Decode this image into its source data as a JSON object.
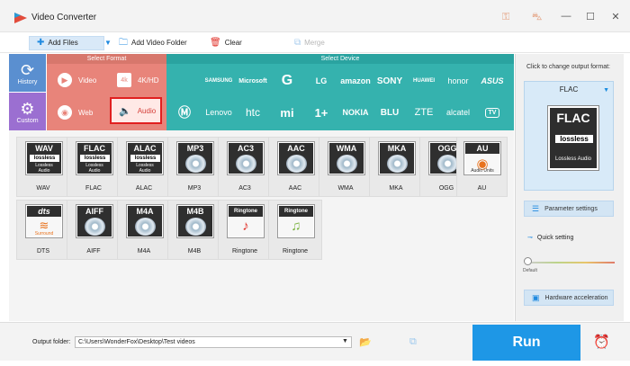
{
  "window": {
    "title": "Video Converter",
    "controls": [
      "—",
      "☐",
      "✕"
    ]
  },
  "toolbar": {
    "add_files": "Add Files",
    "add_video_folder": "Add Video Folder",
    "clear": "Clear",
    "merge": "Merge"
  },
  "sidebar": {
    "history": "History",
    "custom": "Custom"
  },
  "headers": {
    "select_format": "Select Format",
    "select_device": "Select Device"
  },
  "categories": {
    "video": "Video",
    "k4hd": "4K/HD",
    "web": "Web",
    "audio": "Audio",
    "selected": "Audio"
  },
  "devices": {
    "row1": [
      "",
      "SAMSUNG",
      "Microsoft",
      "G",
      "LG",
      "amazon",
      "SONY",
      "HUAWEI",
      "honor",
      "ASUS"
    ],
    "row2": [
      "",
      "Lenovo",
      "htc",
      "mi",
      "1+",
      "NOKIA",
      "BLU",
      "ZTE",
      "alcatel",
      "TV"
    ]
  },
  "formats": [
    {
      "badge": "WAV",
      "label": "WAV",
      "kind": "lossless"
    },
    {
      "badge": "FLAC",
      "label": "FLAC",
      "kind": "lossless"
    },
    {
      "badge": "ALAC",
      "label": "ALAC",
      "kind": "lossless"
    },
    {
      "badge": "MP3",
      "label": "MP3",
      "kind": "disc"
    },
    {
      "badge": "AC3",
      "label": "AC3",
      "kind": "disc"
    },
    {
      "badge": "AAC",
      "label": "AAC",
      "kind": "disc"
    },
    {
      "badge": "WMA",
      "label": "WMA",
      "kind": "disc"
    },
    {
      "badge": "MKA",
      "label": "MKA",
      "kind": "disc"
    },
    {
      "badge": "OGG",
      "label": "OGG",
      "kind": "disc"
    },
    {
      "badge": "AU",
      "label": "AU",
      "kind": "au",
      "sub": "Audio Units"
    },
    {
      "badge": "dts",
      "label": "DTS",
      "kind": "dts",
      "sub": "Surround"
    },
    {
      "badge": "AIFF",
      "label": "AIFF",
      "kind": "disc"
    },
    {
      "badge": "M4A",
      "label": "M4A",
      "kind": "disc"
    },
    {
      "badge": "M4B",
      "label": "M4B",
      "kind": "disc"
    },
    {
      "badge": "Ringtone",
      "label": "Ringtone",
      "kind": "apple"
    },
    {
      "badge": "Ringtone",
      "label": "Ringtone",
      "kind": "android"
    }
  ],
  "lossless_text": {
    "logo": "lossless",
    "line1": "Lossless",
    "line2": "Audio"
  },
  "right_panel": {
    "hint": "Click to change output format:",
    "selected_format": "FLAC",
    "badge": "FLAC",
    "badge_logo": "lossless",
    "badge_sub": "Lossless Audio",
    "parameter_settings": "Parameter settings",
    "quick_setting": "Quick setting",
    "default_label": "Default",
    "hardware_acceleration": "Hardware acceleration"
  },
  "bottom": {
    "output_folder_label": "Output folder:",
    "output_path": "C:\\Users\\WonderFox\\Desktop\\Test videos",
    "run": "Run"
  },
  "colors": {
    "format_red": "#e8847a",
    "device_teal": "#35b2ae",
    "accent_blue": "#1e97e6",
    "selected_border": "#e11f1f"
  }
}
